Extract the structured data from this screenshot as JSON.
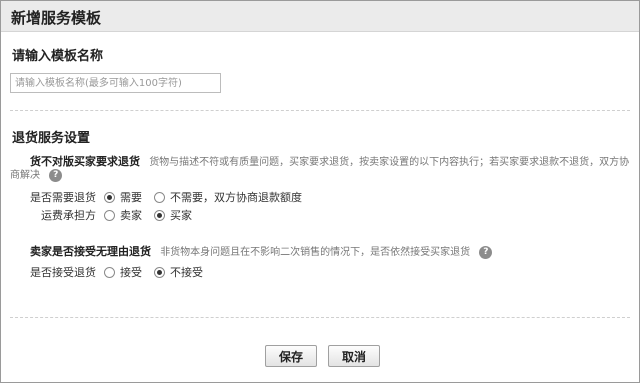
{
  "dialog": {
    "title": "新增服务模板"
  },
  "name_section": {
    "label": "请输入模板名称",
    "placeholder": "请输入模板名称(最多可输入100字符)"
  },
  "return_section": {
    "title": "退货服务设置",
    "rule1": {
      "label": "货不对版买家要求退货",
      "desc_line1": "货物与描述不符或有质量问题，买家要求退货，按卖家设置的以下内容执行；若买家要求退款不退货，双方协",
      "desc_line2": "商解决",
      "need_return": {
        "label": "是否需要退货",
        "options": [
          "需要",
          "不需要，双方协商退款额度"
        ],
        "selected": "需要"
      },
      "shipping_payer": {
        "label": "运费承担方",
        "options": [
          "卖家",
          "买家"
        ],
        "selected": "买家"
      }
    },
    "rule2": {
      "label": "卖家是否接受无理由退货",
      "desc": "非货物本身问题且在不影响二次销售的情况下，是否依然接受买家退货",
      "accept_return": {
        "label": "是否接受退货",
        "options": [
          "接受",
          "不接受"
        ],
        "selected": "不接受"
      }
    }
  },
  "actions": {
    "save_label": "保存",
    "cancel_label": "取消"
  },
  "icons": {
    "help": "help-icon"
  }
}
